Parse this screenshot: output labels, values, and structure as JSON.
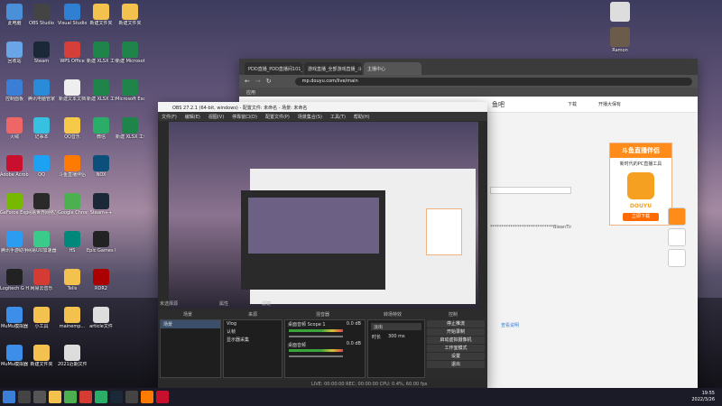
{
  "desktop": {
    "icons": [
      {
        "label": "此电脑",
        "color": "#4a90d9"
      },
      {
        "label": "OBS Studio",
        "color": "#444"
      },
      {
        "label": "Visual Studio Code",
        "color": "#2f7fd2"
      },
      {
        "label": "新建文件夹",
        "color": "#f2c14e"
      },
      {
        "label": "新建文件夹",
        "color": "#f2c14e"
      },
      {
        "label": "回收站",
        "color": "#6aa5e8"
      },
      {
        "label": "Steam",
        "color": "#1b2838"
      },
      {
        "label": "WPS Office",
        "color": "#d43f3a"
      },
      {
        "label": "新建 XLSX 工作表",
        "color": "#1e8449"
      },
      {
        "label": "新建 Microsoft Excel",
        "color": "#1e8449"
      },
      {
        "label": "控制面板",
        "color": "#3a7fd5"
      },
      {
        "label": "腾讯电脑管家",
        "color": "#2a8cd8"
      },
      {
        "label": "新建文本文档",
        "color": "#eeeeee"
      },
      {
        "label": "新建 XLSX 工作表",
        "color": "#1e8449"
      },
      {
        "label": "Microsoft Excel",
        "color": "#1e8449"
      },
      {
        "label": "火绒",
        "color": "#e66"
      },
      {
        "label": "记事本",
        "color": "#38c0e0"
      },
      {
        "label": "QQ音乐",
        "color": "#f7c948"
      },
      {
        "label": "微信",
        "color": "#2aae67"
      },
      {
        "label": "新建 XLSX 工作表",
        "color": "#1e8449"
      },
      {
        "label": "Adobe Acrobat DC",
        "color": "#c8102e"
      },
      {
        "label": "QQ",
        "color": "#1da1f2"
      },
      {
        "label": "斗鱼直播伴侣",
        "color": "#ff7a00"
      },
      {
        "label": "NOX",
        "color": "#0c4f7a"
      },
      {
        "label": "GeForce Experience",
        "color": "#76b900"
      },
      {
        "label": "网易世界网络加速",
        "color": "#2a2a2a"
      },
      {
        "label": "Google Chrome",
        "color": "#4caf50"
      },
      {
        "label": "Steam++",
        "color": "#1b2838"
      },
      {
        "label": "腾讯手游助手",
        "color": "#2c9cf0"
      },
      {
        "label": "网易UU加速器",
        "color": "#3acb8a"
      },
      {
        "label": "HS",
        "color": "#00897b"
      },
      {
        "label": "Epic Games Launcher",
        "color": "#222"
      },
      {
        "label": "Logitech G HUB",
        "color": "#222"
      },
      {
        "label": "网易云音乐",
        "color": "#d43c33"
      },
      {
        "label": "Telis",
        "color": "#f2c14e"
      },
      {
        "label": "MuMu模拟器",
        "color": "#3d8ee8"
      },
      {
        "label": "小工具",
        "color": "#f2c14e"
      },
      {
        "label": "mainemp...",
        "color": "#f2c14e"
      },
      {
        "label": "RDR2",
        "color": "#a00"
      },
      {
        "label": "MuMu模拟器",
        "color": "#3d8ee8"
      },
      {
        "label": "新建文件夹",
        "color": "#f2c14e"
      },
      {
        "label": "2021近期文件",
        "color": "#ddd"
      },
      {
        "label": "article文件",
        "color": "#ddd"
      }
    ]
  },
  "chrome": {
    "tabs": [
      "PDD直播_PDD直播间101_斗鱼",
      "游戏直播_全部游戏直播_斗鱼直播",
      "主播中心"
    ],
    "url": "mp.douyu.com/live/main",
    "bookmarks": "应用",
    "page_header": "鱼吧",
    "download_label": "下载",
    "user_label": "开播大保有",
    "promo_title": "斗鱼直播伴侣",
    "promo_sub": "新时代的PC直播工具",
    "promo_btn": "立即下载",
    "promo_brand": "DOUYU",
    "link1": "查看说明",
    "key_text": "****************************BleanTim"
  },
  "obs": {
    "title": "OBS 27.2.1 (64-bit, windows) - 配置文件: 未命名 - 场景: 未命名",
    "menu": [
      "文件(F)",
      "编辑(E)",
      "视图(V)",
      "停靠窗口(D)",
      "配置文件(P)",
      "场景集合(S)",
      "工具(T)",
      "帮助(H)"
    ],
    "no_source": "未选择源",
    "properties": "属性",
    "filters": "滤镜",
    "dock_scenes": "场景",
    "dock_sources": "来源",
    "dock_mixer": "混音器",
    "dock_transitions": "转场特效",
    "dock_controls": "控制",
    "scene_item": "场景",
    "sources": [
      "Vlog",
      "认帧",
      "显示器采集"
    ],
    "mixer": [
      {
        "name": "桌面音频 Scope 1",
        "db": "0.0 dB"
      },
      {
        "name": "桌面音频",
        "db": "0.0 dB"
      }
    ],
    "transition": "淡出",
    "duration_label": "时长",
    "duration": "300 ms",
    "controls": [
      "停止推流",
      "开始录制",
      "启动虚拟摄像机",
      "工作室模式",
      "设置",
      "退出"
    ],
    "status": "LIVE: 00:00:00   REC: 00:00:00   CPU: 0.4%, 60.00 fps"
  },
  "taskbar": {
    "time": "19:55",
    "date": "2022/3/26",
    "user_name": "Ramon"
  }
}
